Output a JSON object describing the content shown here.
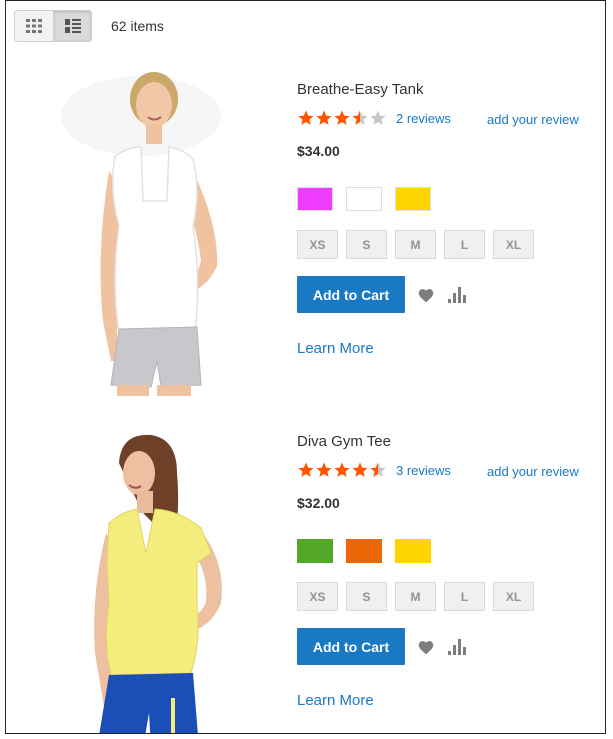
{
  "toolbar": {
    "modes": [
      {
        "icon": "grid-icon",
        "label": "Grid",
        "active": false
      },
      {
        "icon": "list-icon",
        "label": "List",
        "active": true
      }
    ],
    "amount": "62 items"
  },
  "products": [
    {
      "name": "Breathe-Easy Tank",
      "rating_out_of_5": 3.5,
      "reviews": "2 reviews",
      "add_review": "add your review",
      "price": "$34.00",
      "colors": [
        "#ef3dff",
        "#ffffff",
        "#ffd500"
      ],
      "sizes": [
        "XS",
        "S",
        "M",
        "L",
        "XL"
      ],
      "add_to_cart": "Add to Cart",
      "learn_more": "Learn More",
      "image": "woman-in-white-tank-top-and-grey-shorts"
    },
    {
      "name": "Diva Gym Tee",
      "rating_out_of_5": 4.5,
      "reviews": "3 reviews",
      "add_review": "add your review",
      "price": "$32.00",
      "colors": [
        "#53a828",
        "#eb6703",
        "#ffd500"
      ],
      "sizes": [
        "XS",
        "S",
        "M",
        "L",
        "XL"
      ],
      "add_to_cart": "Add to Cart",
      "learn_more": "Learn More",
      "image": "woman-in-yellow-v-neck-tee-and-blue-shorts"
    }
  ],
  "colors": {
    "link": "#1979c3",
    "star_filled": "#ff5501",
    "star_empty": "#c7c7c7",
    "button": "#1979c3"
  }
}
